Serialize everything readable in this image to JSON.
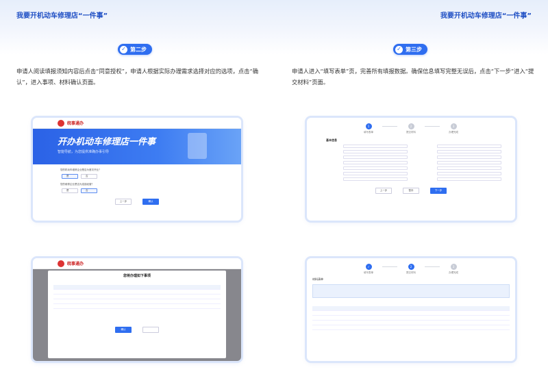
{
  "titles": {
    "left": "我要开机动车修理店“一件事”",
    "right": "我要开机动车修理店“一件事”"
  },
  "steps": [
    {
      "badge": "第二步",
      "text": "申请人阅读填报须知内容后点击“同意授权”，申请人根据实际办理需求选择对应的选项，点击“确认”，进入事项、材料确认页面。"
    },
    {
      "badge": "第三步",
      "text": "申请人进入“填写表单”页，完善所有填报数据。确保信息填写完整无误后，点击“下一步”进入“提交材料”页面。"
    }
  ],
  "shot1": {
    "logo": "皖事通办",
    "banner_title": "开办机动车修理店一件事",
    "banner_sub": "智能导航，为您提供准确办事引导",
    "q1": "您的机动车维修企业是否为首次开业？",
    "q2": "您的维修企业是否为连锁经营？",
    "opt_yes": "是",
    "opt_no": "否",
    "btn_prev": "上一步",
    "btn_confirm": "确认"
  },
  "shot2": {
    "steps": [
      "填写表单",
      "提交材料",
      "办理完成"
    ],
    "form_title": "基本信息",
    "btn_save": "暂存",
    "btn_next": "下一步"
  },
  "shot3": {
    "modal_title": "您将办理如下事项"
  },
  "shot4": {
    "steps": [
      "填写表单",
      "提交材料",
      "办理完成"
    ],
    "section_title": "材料清单"
  },
  "colors": {
    "brand": "#2f6ef0",
    "title": "#1f4fc4"
  }
}
